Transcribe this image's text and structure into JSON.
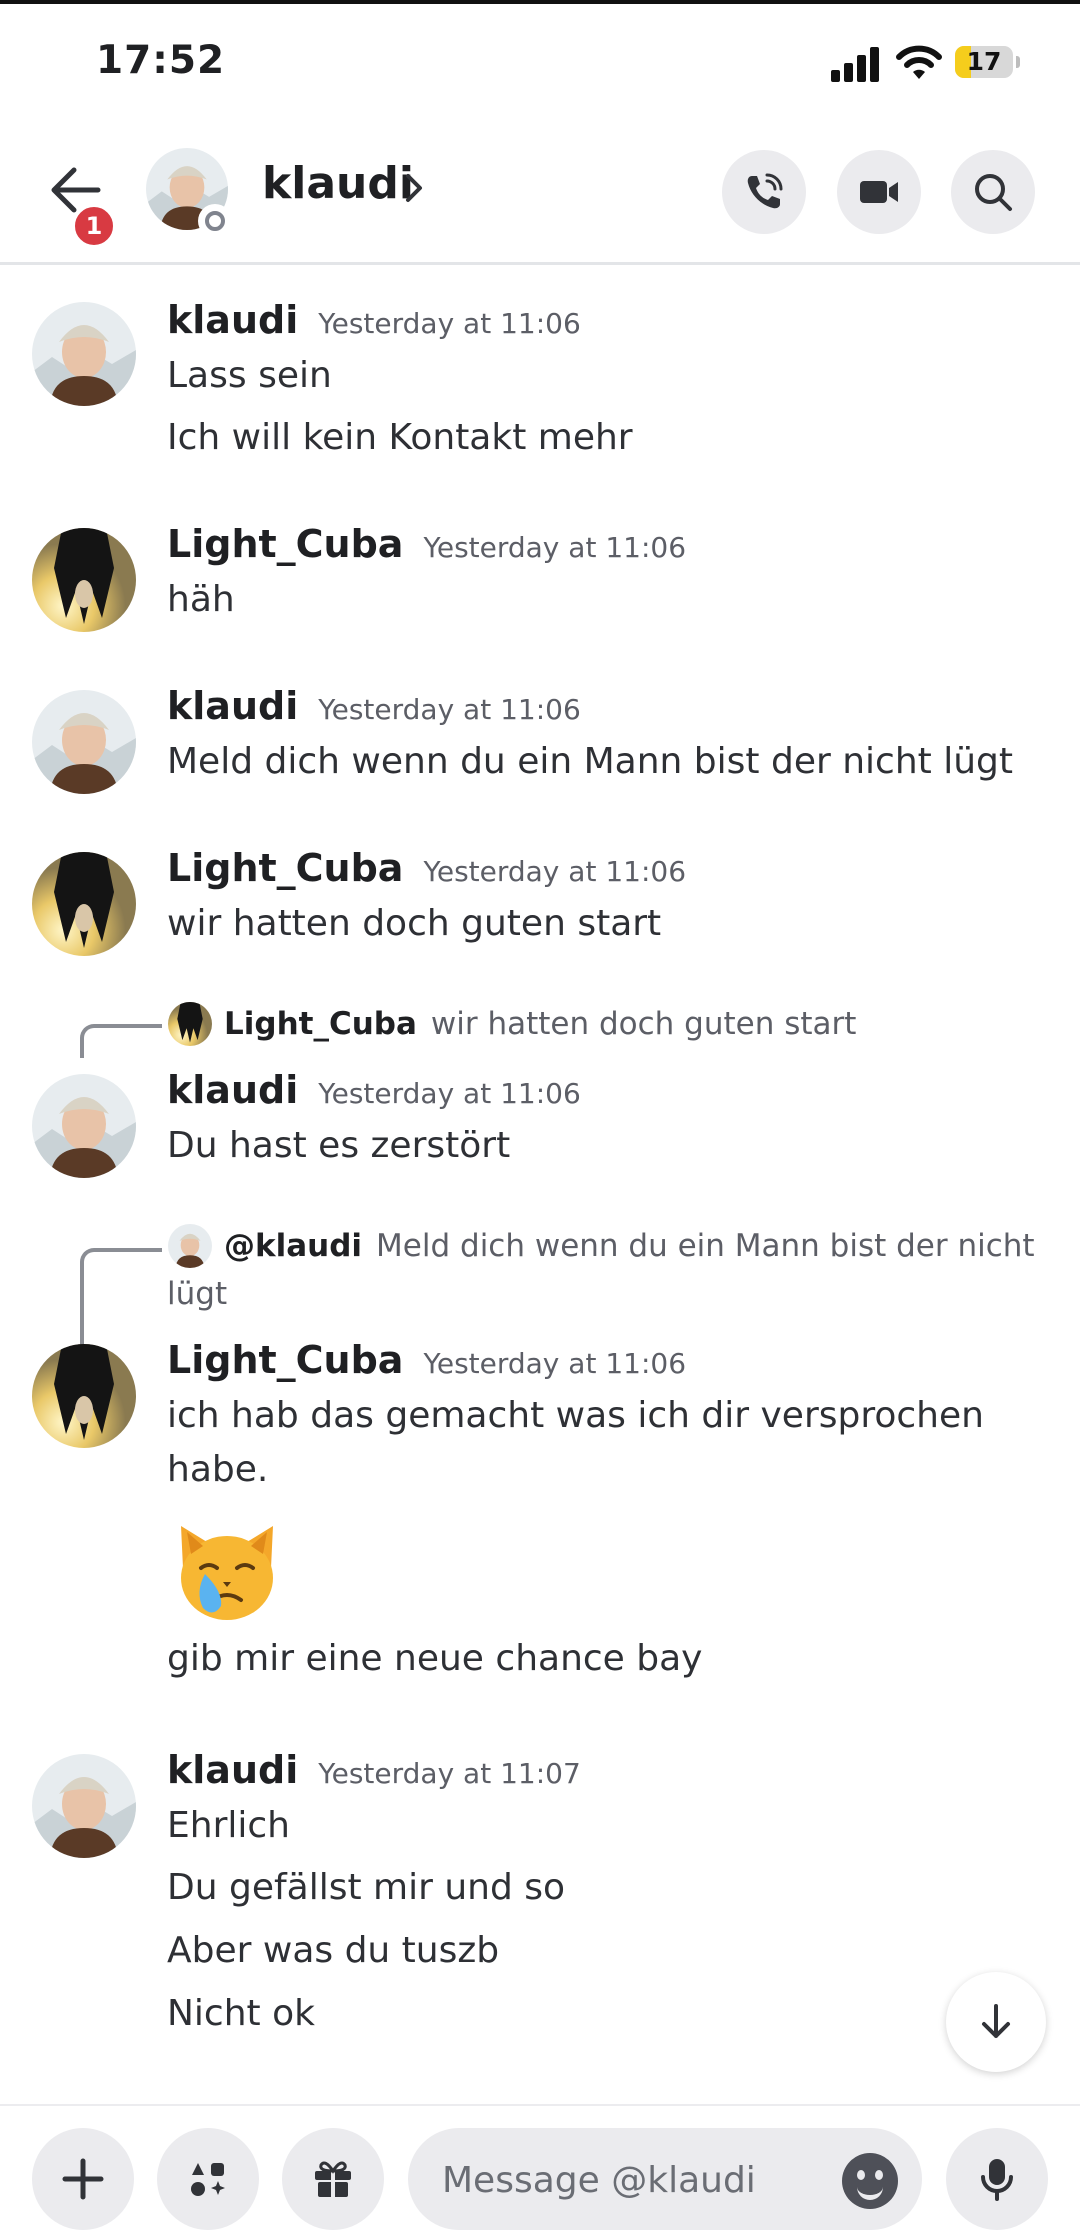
{
  "status_bar": {
    "time": "17:52",
    "battery": "17"
  },
  "header": {
    "back_badge": "1",
    "name": "klaudi"
  },
  "composer": {
    "placeholder": "Message @klaudi"
  },
  "messages": [
    {
      "author": "klaudi",
      "timestamp": "Yesterday at 11:06",
      "lines": [
        "Lass sein",
        "Ich will kein Kontakt mehr"
      ]
    },
    {
      "author": "Light_Cuba",
      "timestamp": "Yesterday at 11:06",
      "lines": [
        "häh"
      ]
    },
    {
      "author": "klaudi",
      "timestamp": "Yesterday at 11:06",
      "lines": [
        "Meld dich wenn du ein Mann bist der nicht lügt"
      ]
    },
    {
      "author": "Light_Cuba",
      "timestamp": "Yesterday at 11:06",
      "lines": [
        "wir hatten doch guten start"
      ]
    },
    {
      "reply": {
        "author": "Light_Cuba",
        "text": "wir hatten doch guten start"
      },
      "author": "klaudi",
      "timestamp": "Yesterday at 11:06",
      "lines": [
        "Du hast es zerstört"
      ]
    },
    {
      "reply": {
        "author": "@klaudi",
        "text": "Meld dich wenn du ein Mann bist der nicht",
        "text_wrap": "lügt"
      },
      "author": "Light_Cuba",
      "timestamp": "Yesterday at 11:06",
      "lines": [
        "ich hab das gemacht was ich dir versprochen",
        "habe."
      ],
      "emoji": "crying-cat-emoji",
      "after_emoji": "gib mir eine neue chance bay"
    },
    {
      "author": "klaudi",
      "timestamp": "Yesterday at 11:07",
      "lines": [
        "Ehrlich",
        "Du gefällst mir und so",
        "Aber was du tuszb",
        "Nicht ok"
      ]
    }
  ],
  "icons": [
    "back-arrow-icon",
    "phone-icon",
    "video-icon",
    "search-icon",
    "arrow-down-icon",
    "plus-icon",
    "apps-icon",
    "gift-icon",
    "emoji-icon",
    "microphone-icon"
  ]
}
